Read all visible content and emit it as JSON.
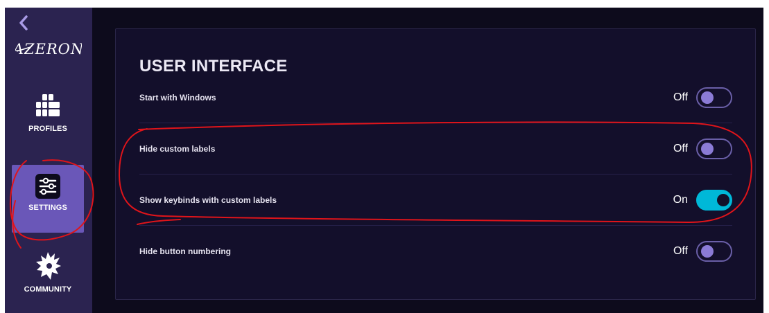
{
  "app": {
    "logo_text": "AZERON",
    "accent_color": "#6a57b8",
    "toggle_on_color": "#00b8d8"
  },
  "sidebar": {
    "items": [
      {
        "label": "PROFILES",
        "icon": "grid-icon",
        "active": false
      },
      {
        "label": "SETTINGS",
        "icon": "sliders-icon",
        "active": true
      },
      {
        "label": "COMMUNITY",
        "icon": "dragon-icon",
        "active": false
      }
    ]
  },
  "main": {
    "section_title": "USER INTERFACE",
    "settings": [
      {
        "label": "Start with Windows",
        "state_text": "Off",
        "on": false
      },
      {
        "label": "Hide custom labels",
        "state_text": "Off",
        "on": false
      },
      {
        "label": "Show keybinds with custom labels",
        "state_text": "On",
        "on": true
      },
      {
        "label": "Hide button numbering",
        "state_text": "Off",
        "on": false
      }
    ]
  },
  "annotations": {
    "color": "#e0141a"
  }
}
